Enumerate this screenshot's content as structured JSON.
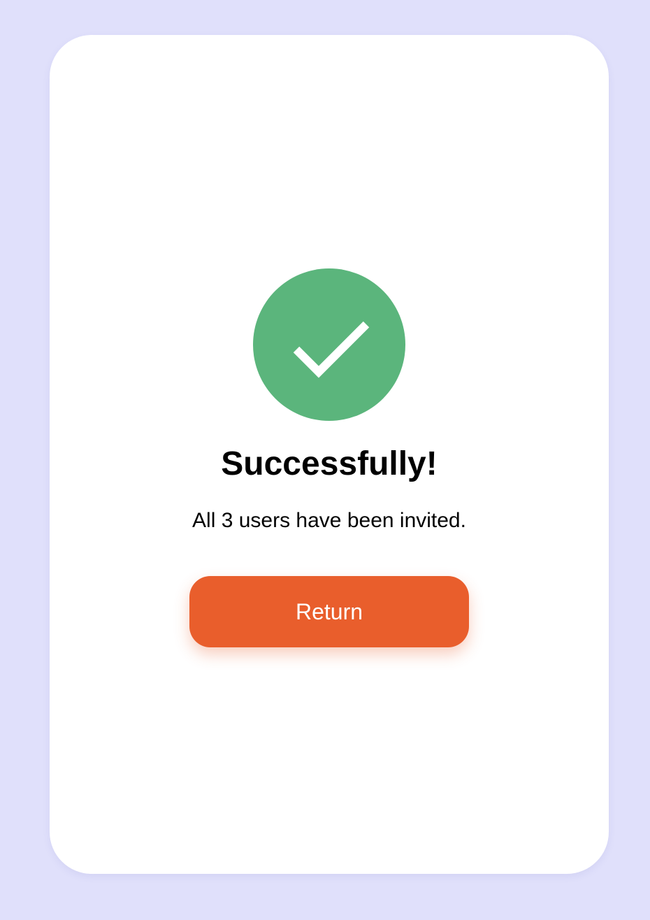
{
  "dialog": {
    "title": "Successfully!",
    "message": "All 3 users have been invited.",
    "return_label": "Return"
  },
  "icons": {
    "status": "check-icon"
  },
  "colors": {
    "background": "#e0e0fb",
    "card": "#ffffff",
    "success": "#5bb57c",
    "accent": "#e95e2c"
  }
}
